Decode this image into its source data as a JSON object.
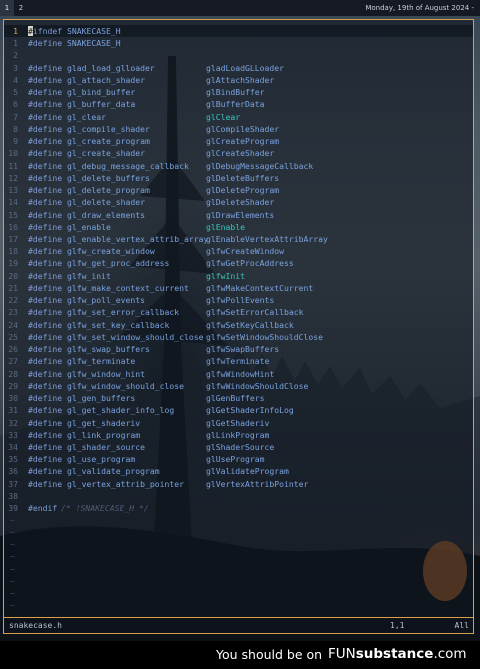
{
  "topbar": {
    "workspaces": [
      "1",
      "2"
    ],
    "clock": "Monday, 19th of August 2024 -"
  },
  "editor": {
    "lines": [
      {
        "n": "1",
        "type": "ifndef",
        "kw": "#ifndef",
        "name": "SNAKECASE_H",
        "val": "",
        "current": true
      },
      {
        "n": "1",
        "type": "define",
        "kw": "#define",
        "name": "SNAKECASE_H",
        "val": ""
      },
      {
        "n": "2",
        "type": "blank"
      },
      {
        "n": "3",
        "type": "define",
        "kw": "#define",
        "name": "glad_load_glloader",
        "val": "gladLoadGLLoader"
      },
      {
        "n": "4",
        "type": "define",
        "kw": "#define",
        "name": "gl_attach_shader",
        "val": "glAttachShader"
      },
      {
        "n": "5",
        "type": "define",
        "kw": "#define",
        "name": "gl_bind_buffer",
        "val": "glBindBuffer"
      },
      {
        "n": "6",
        "type": "define",
        "kw": "#define",
        "name": "gl_buffer_data",
        "val": "glBufferData"
      },
      {
        "n": "7",
        "type": "define",
        "kw": "#define",
        "name": "gl_clear",
        "val": "glClear",
        "hl": true
      },
      {
        "n": "8",
        "type": "define",
        "kw": "#define",
        "name": "gl_compile_shader",
        "val": "glCompileShader"
      },
      {
        "n": "9",
        "type": "define",
        "kw": "#define",
        "name": "gl_create_program",
        "val": "glCreateProgram"
      },
      {
        "n": "10",
        "type": "define",
        "kw": "#define",
        "name": "gl_create_shader",
        "val": "glCreateShader"
      },
      {
        "n": "11",
        "type": "define",
        "kw": "#define",
        "name": "gl_debug_message_callback",
        "val": "glDebugMessageCallback"
      },
      {
        "n": "12",
        "type": "define",
        "kw": "#define",
        "name": "gl_delete_buffers",
        "val": "glDeleteBuffers"
      },
      {
        "n": "13",
        "type": "define",
        "kw": "#define",
        "name": "gl_delete_program",
        "val": "glDeleteProgram"
      },
      {
        "n": "14",
        "type": "define",
        "kw": "#define",
        "name": "gl_delete_shader",
        "val": "glDeleteShader"
      },
      {
        "n": "15",
        "type": "define",
        "kw": "#define",
        "name": "gl_draw_elements",
        "val": "glDrawElements"
      },
      {
        "n": "16",
        "type": "define",
        "kw": "#define",
        "name": "gl_enable",
        "val": "glEnable",
        "hl": true
      },
      {
        "n": "17",
        "type": "define",
        "kw": "#define",
        "name": "gl_enable_vertex_attrib_array",
        "val": "glEnableVertexAttribArray"
      },
      {
        "n": "18",
        "type": "define",
        "kw": "#define",
        "name": "glfw_create_window",
        "val": "glfwCreateWindow"
      },
      {
        "n": "19",
        "type": "define",
        "kw": "#define",
        "name": "glfw_get_proc_address",
        "val": "glfwGetProcAddress"
      },
      {
        "n": "20",
        "type": "define",
        "kw": "#define",
        "name": "glfw_init",
        "val": "glfwInit",
        "hl": true
      },
      {
        "n": "21",
        "type": "define",
        "kw": "#define",
        "name": "glfw_make_context_current",
        "val": "glfwMakeContextCurrent"
      },
      {
        "n": "22",
        "type": "define",
        "kw": "#define",
        "name": "glfw_poll_events",
        "val": "glfwPollEvents"
      },
      {
        "n": "23",
        "type": "define",
        "kw": "#define",
        "name": "glfw_set_error_callback",
        "val": "glfwSetErrorCallback"
      },
      {
        "n": "24",
        "type": "define",
        "kw": "#define",
        "name": "glfw_set_key_callback",
        "val": "glfwSetKeyCallback"
      },
      {
        "n": "25",
        "type": "define",
        "kw": "#define",
        "name": "glfw_set_window_should_close",
        "val": "glfwSetWindowShouldClose"
      },
      {
        "n": "26",
        "type": "define",
        "kw": "#define",
        "name": "glfw_swap_buffers",
        "val": "glfwSwapBuffers"
      },
      {
        "n": "27",
        "type": "define",
        "kw": "#define",
        "name": "glfw_terminate",
        "val": "glfwTerminate"
      },
      {
        "n": "28",
        "type": "define",
        "kw": "#define",
        "name": "glfw_window_hint",
        "val": "glfwWindowHint"
      },
      {
        "n": "29",
        "type": "define",
        "kw": "#define",
        "name": "glfw_window_should_close",
        "val": "glfwWindowShouldClose"
      },
      {
        "n": "30",
        "type": "define",
        "kw": "#define",
        "name": "gl_gen_buffers",
        "val": "glGenBuffers"
      },
      {
        "n": "31",
        "type": "define",
        "kw": "#define",
        "name": "gl_get_shader_info_log",
        "val": "glGetShaderInfoLog"
      },
      {
        "n": "32",
        "type": "define",
        "kw": "#define",
        "name": "gl_get_shaderiv",
        "val": "glGetShaderiv"
      },
      {
        "n": "33",
        "type": "define",
        "kw": "#define",
        "name": "gl_link_program",
        "val": "glLinkProgram"
      },
      {
        "n": "34",
        "type": "define",
        "kw": "#define",
        "name": "gl_shader_source",
        "val": "glShaderSource"
      },
      {
        "n": "35",
        "type": "define",
        "kw": "#define",
        "name": "gl_use_program",
        "val": "glUseProgram"
      },
      {
        "n": "36",
        "type": "define",
        "kw": "#define",
        "name": "gl_validate_program",
        "val": "glValidateProgram"
      },
      {
        "n": "37",
        "type": "define",
        "kw": "#define",
        "name": "gl_vertex_attrib_pointer",
        "val": "glVertexAttribPointer"
      },
      {
        "n": "38",
        "type": "blank"
      },
      {
        "n": "39",
        "type": "endif",
        "kw": "#endif",
        "comment": "/* !SNAKECASE_H */"
      }
    ]
  },
  "statusline": {
    "filename": "snakecase.h",
    "position": "1,1",
    "percent": "All"
  },
  "watermark": {
    "left_text": "You should be on",
    "brand_light": "FUN",
    "brand_bold": "substance",
    "brand_tail": ".com"
  },
  "colors": {
    "accent_border": "#d7a04a",
    "macro": "#7aa2e0",
    "highlight_macro": "#38c6c0",
    "line_number": "#5a6b82",
    "current_line_number": "#e1a346",
    "comment": "#4d5d78"
  },
  "icons": [
    "tilde-marker"
  ]
}
